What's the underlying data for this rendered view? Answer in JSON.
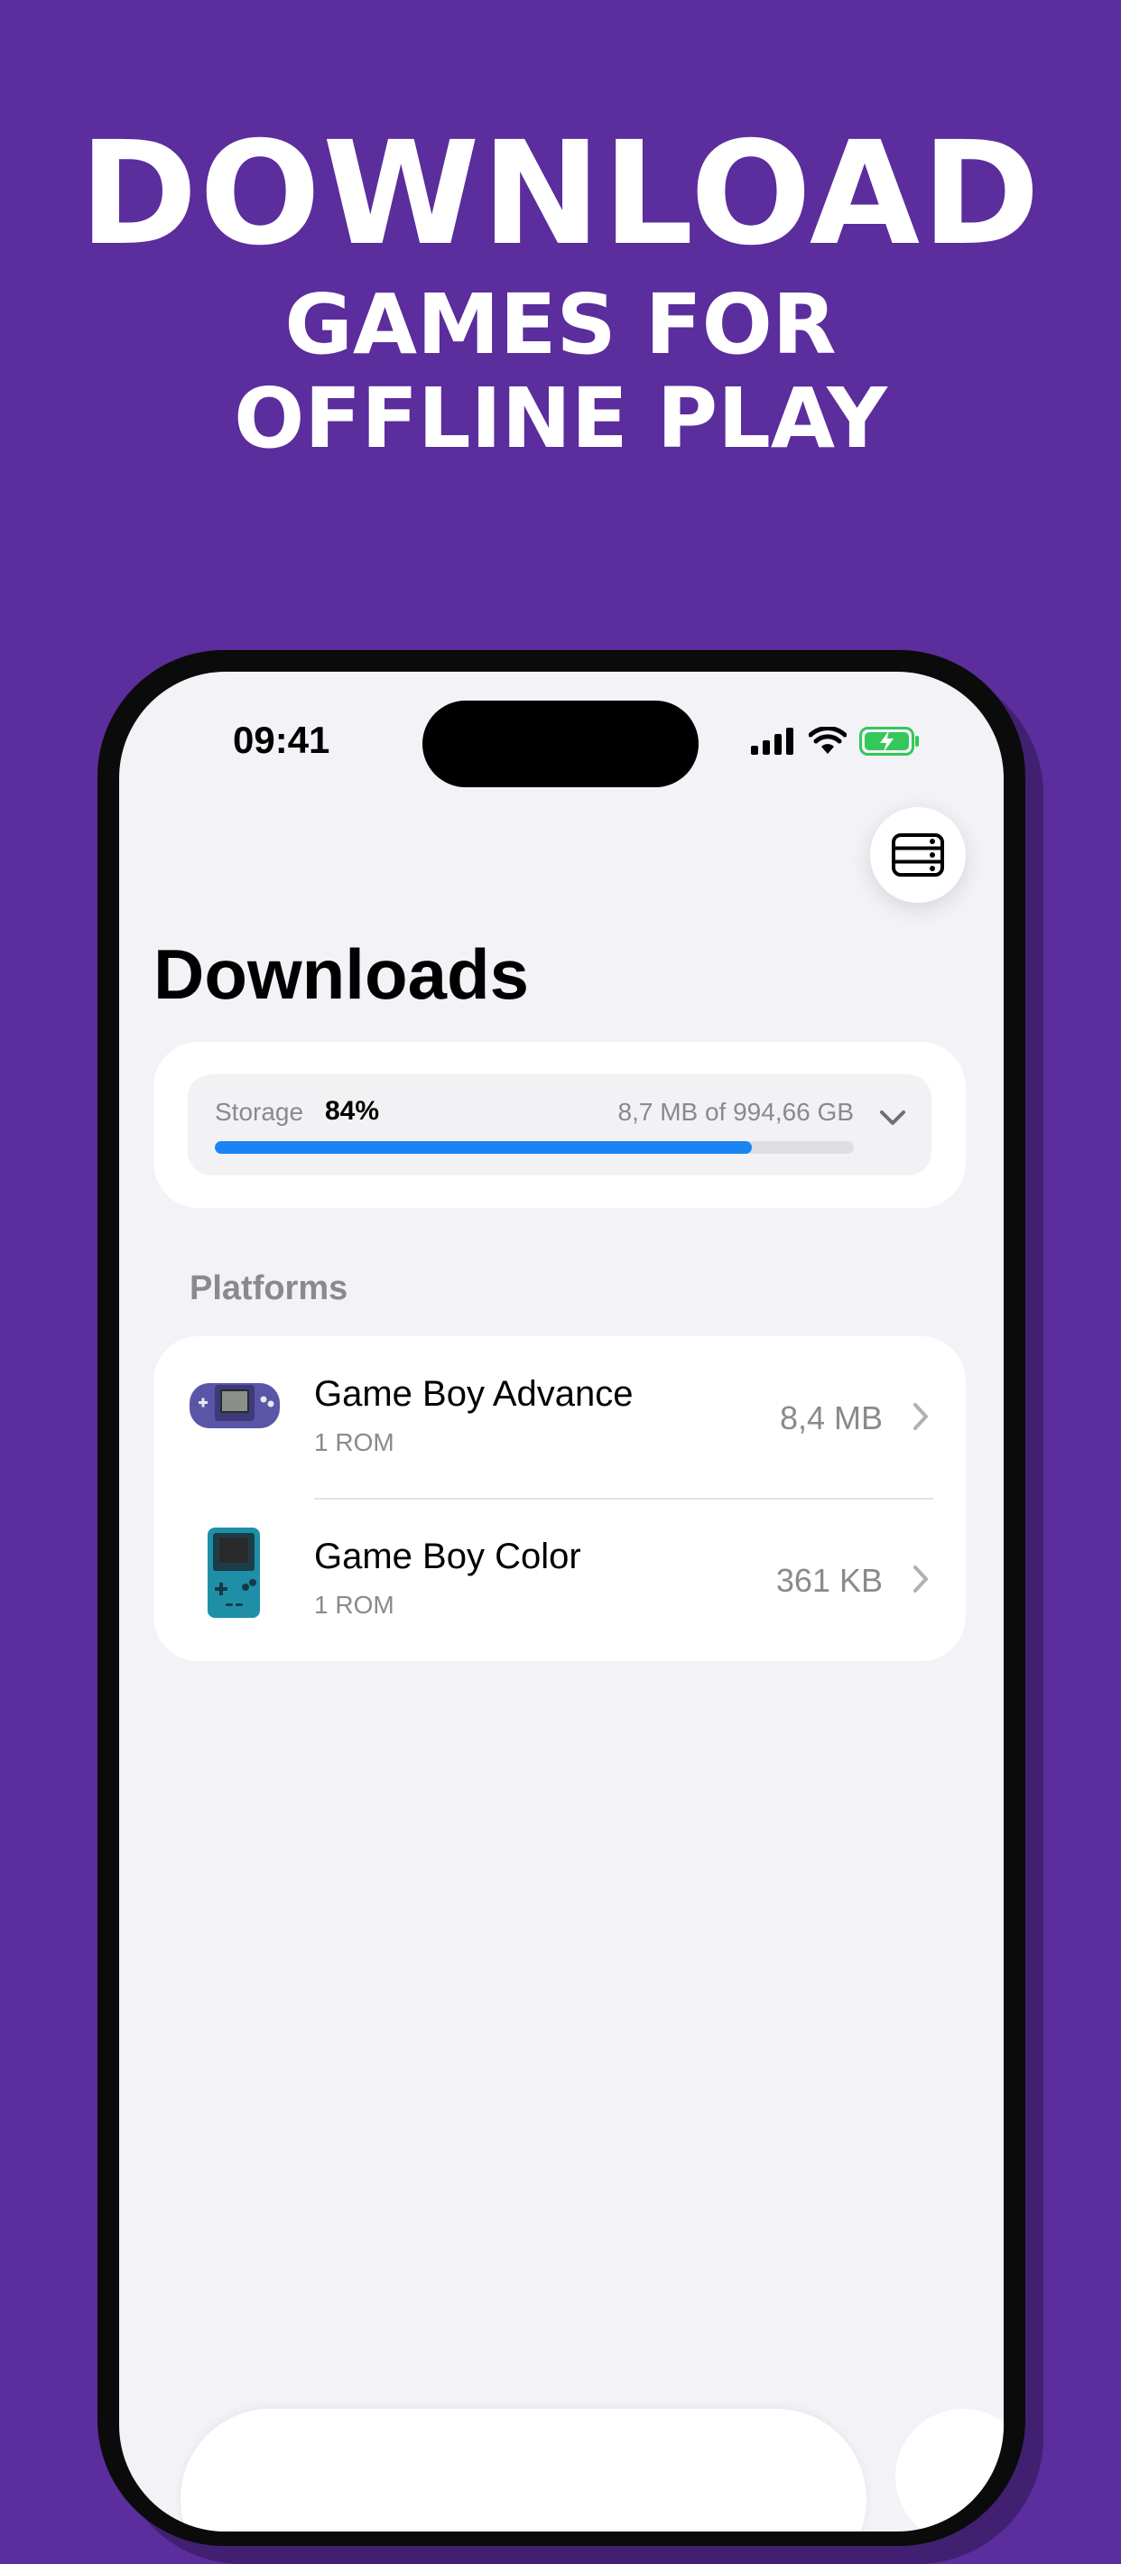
{
  "headline": {
    "line1": "DOWNLOAD",
    "line2": "GAMES FOR",
    "line3": "OFFLINE PLAY"
  },
  "status_bar": {
    "time": "09:41"
  },
  "page": {
    "title": "Downloads"
  },
  "storage": {
    "label": "Storage",
    "percent": "84%",
    "used_fraction": 0.84,
    "size_text": "8,7 MB of 994,66 GB"
  },
  "platforms": {
    "section_label": "Platforms",
    "items": [
      {
        "name": "Game Boy Advance",
        "count": "1 ROM",
        "size": "8,4 MB"
      },
      {
        "name": "Game Boy Color",
        "count": "1 ROM",
        "size": "361 KB"
      }
    ]
  },
  "colors": {
    "background": "#5b2d9d",
    "accent": "#1a84f2",
    "gba": "#5a55a6",
    "gbc": "#1f8fa7"
  },
  "icons": {
    "storage_button": "server-stack-icon",
    "expand": "chevron-down-icon",
    "row_disclosure": "chevron-right-icon"
  }
}
